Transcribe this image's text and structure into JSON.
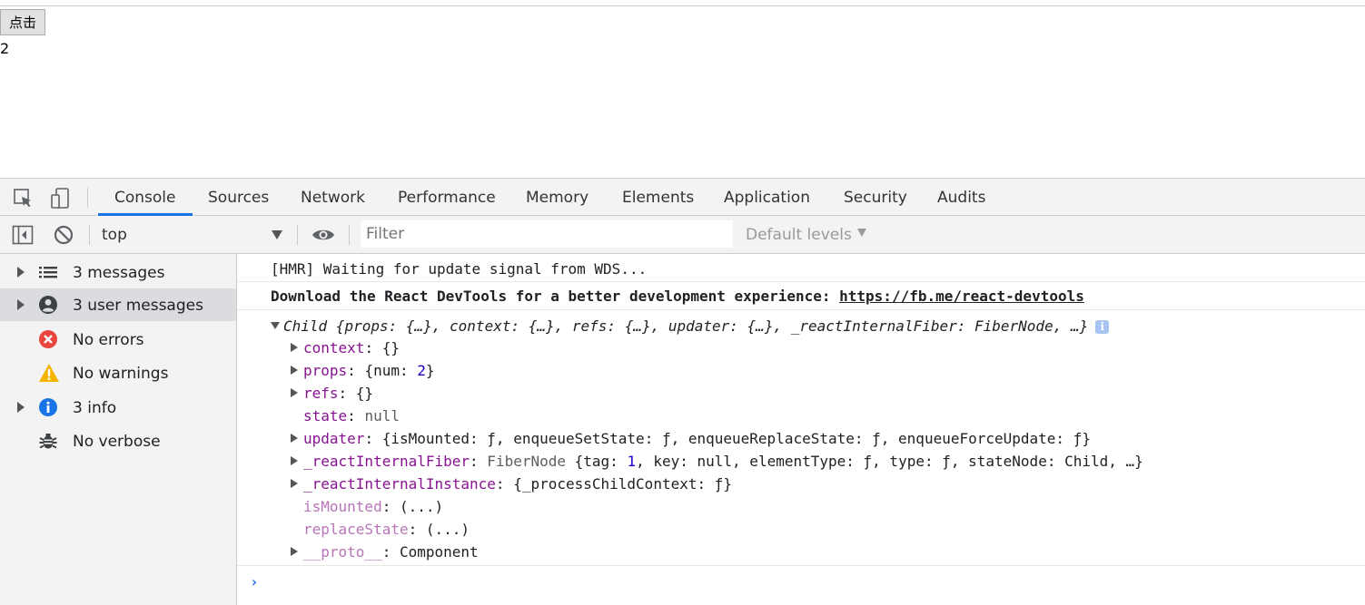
{
  "page": {
    "button_label": "点击",
    "counter_value": "2"
  },
  "devtools": {
    "tabs": [
      {
        "label": "Console",
        "active": true
      },
      {
        "label": "Sources"
      },
      {
        "label": "Network"
      },
      {
        "label": "Performance"
      },
      {
        "label": "Memory"
      },
      {
        "label": "Elements"
      },
      {
        "label": "Application"
      },
      {
        "label": "Security"
      },
      {
        "label": "Audits"
      }
    ],
    "toolbar": {
      "context": "top",
      "filter_placeholder": "Filter",
      "levels_label": "Default levels"
    },
    "sidebar": {
      "items": [
        {
          "label": "3 messages",
          "icon": "list-icon"
        },
        {
          "label": "3 user messages",
          "icon": "user-icon"
        },
        {
          "label": "No errors",
          "icon": "error-icon"
        },
        {
          "label": "No warnings",
          "icon": "warning-icon"
        },
        {
          "label": "3 info",
          "icon": "info-icon"
        },
        {
          "label": "No verbose",
          "icon": "bug-icon"
        }
      ]
    },
    "console": {
      "msg1": "[HMR] Waiting for update signal from WDS...",
      "msg2_text": "Download the React DevTools for a better development experience: ",
      "msg2_link": "https://fb.me/react-devtools",
      "object_summary_name": "Child",
      "object_summary_body": " {props: {…}, context: {…}, refs: {…}, updater: {…}, _reactInternalFiber: FiberNode, …}",
      "info_badge": "i",
      "props": {
        "context_key": "context",
        "context_val": "{}",
        "props_key": "props",
        "props_val_open": "{num: ",
        "props_val_num": "2",
        "props_val_close": "}",
        "refs_key": "refs",
        "refs_val": "{}",
        "state_key": "state",
        "state_val": "null",
        "updater_key": "updater",
        "updater_val": "{isMounted: ƒ, enqueueSetState: ƒ, enqueueReplaceState: ƒ, enqueueForceUpdate: ƒ}",
        "fiber_key": "_reactInternalFiber",
        "fiber_type": "FiberNode",
        "fiber_open": " {tag: ",
        "fiber_tag": "1",
        "fiber_rest": ", key: null, elementType: ƒ, type: ƒ, stateNode: Child, …}",
        "instance_key": "_reactInternalInstance",
        "instance_val": "{_processChildContext: ƒ}",
        "ismounted_key": "isMounted",
        "ismounted_val": "(...)",
        "replacestate_key": "replaceState",
        "replacestate_val": "(...)",
        "proto_key": "__proto__",
        "proto_val": "Component"
      },
      "prompt": "›"
    }
  }
}
